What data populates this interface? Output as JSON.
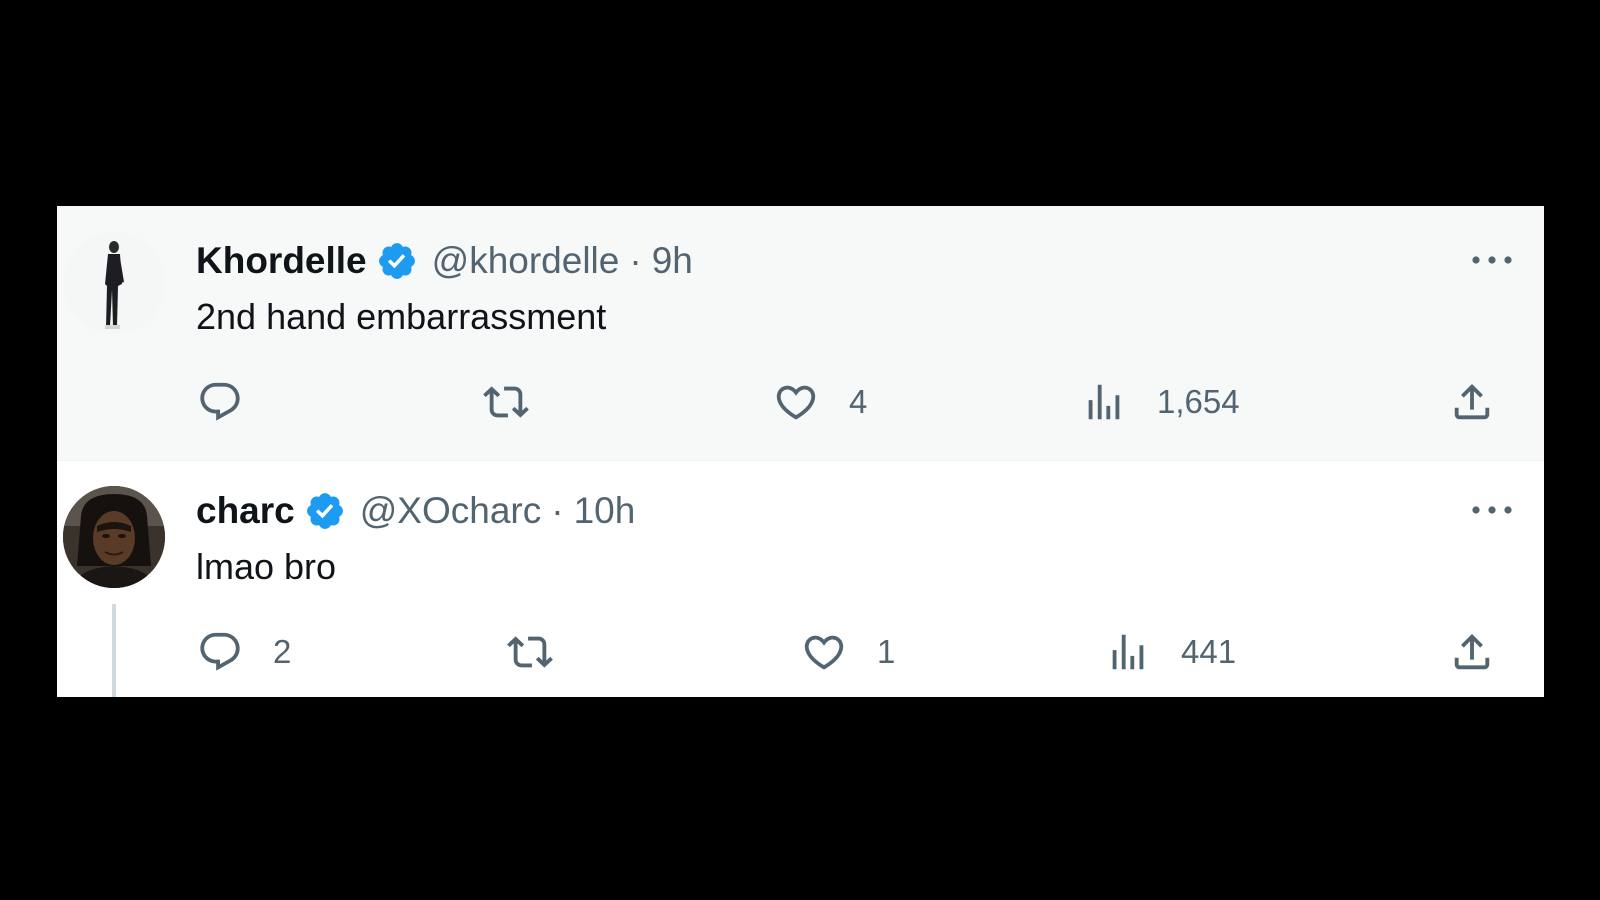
{
  "tweets": [
    {
      "display_name": "Khordelle",
      "handle": "@khordelle",
      "separator": "·",
      "time": "9h",
      "text": "2nd hand embarrassment",
      "verified": true,
      "replies": "",
      "reposts": "",
      "likes": "4",
      "views": "1,654"
    },
    {
      "display_name": "charc",
      "handle": "@XOcharc",
      "separator": "·",
      "time": "10h",
      "text": "lmao bro",
      "verified": true,
      "replies": "2",
      "reposts": "",
      "likes": "1",
      "views": "441"
    }
  ],
  "icons": {
    "more": "more-horizontal-icon",
    "reply": "reply-icon",
    "repost": "repost-icon",
    "like": "heart-icon",
    "views": "analytics-icon",
    "share": "share-icon",
    "verified": "verified-badge-icon"
  },
  "colors": {
    "background": "#000000",
    "highlighted_tweet_bg": "#f7f9f9",
    "tweet_bg": "#ffffff",
    "primary_text": "#0f1419",
    "secondary_text": "#536471",
    "verified_blue": "#1d9bf0"
  }
}
